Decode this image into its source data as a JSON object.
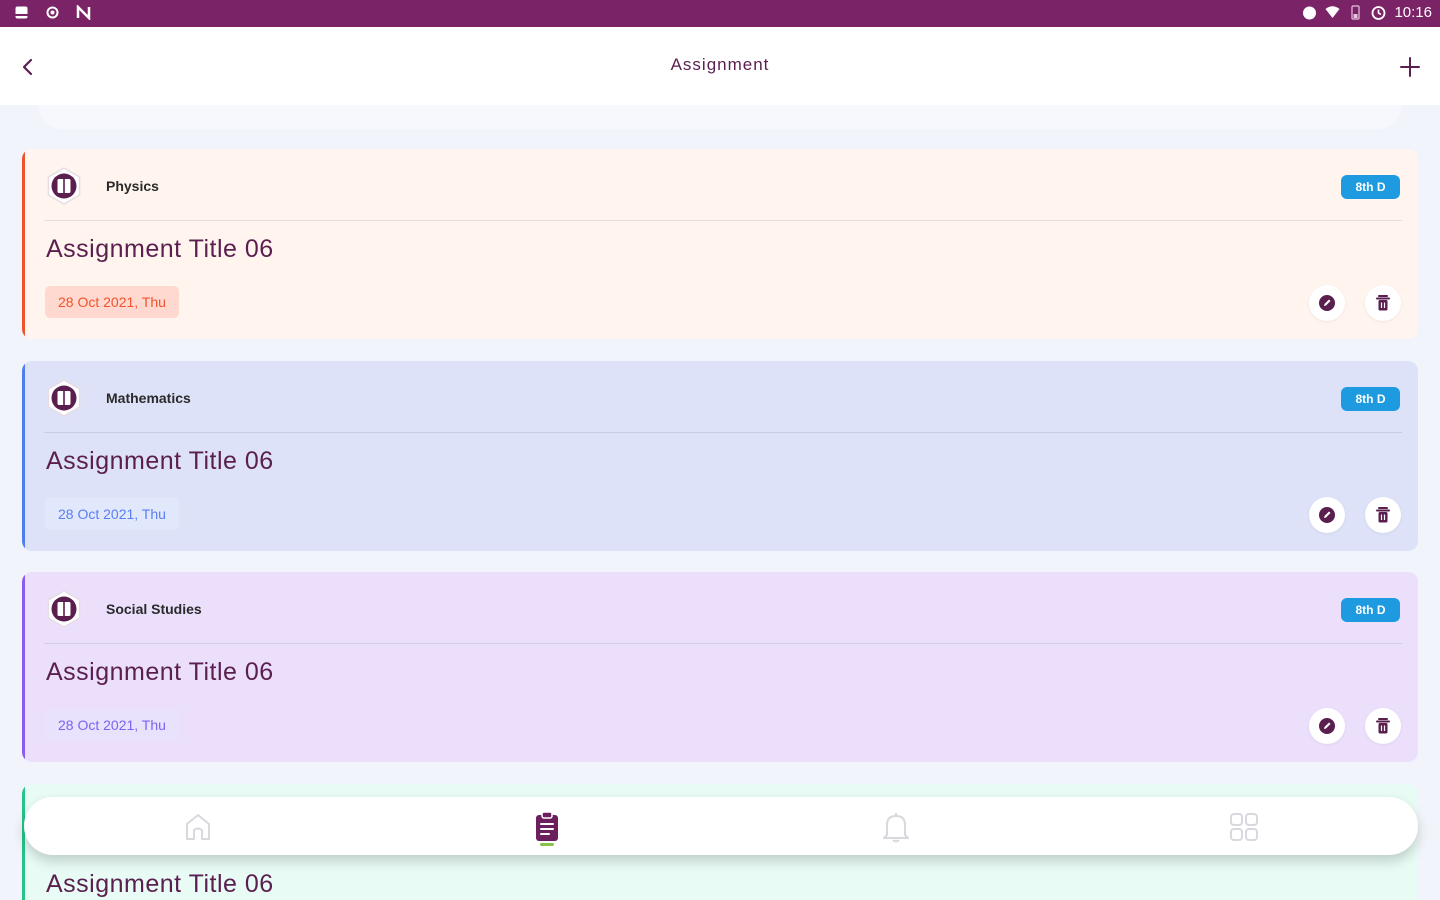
{
  "status_bar": {
    "time": "10:16"
  },
  "header": {
    "title": "Assignment"
  },
  "assignments": [
    {
      "subject": "Physics",
      "class_label": "8th D",
      "title": "Assignment Title 06",
      "date": "28 Oct 2021, Thu",
      "accent": "#f0532c"
    },
    {
      "subject": "Mathematics",
      "class_label": "8th D",
      "title": "Assignment Title 06",
      "date": "28 Oct 2021, Thu",
      "accent": "#4f7ef0"
    },
    {
      "subject": "Social Studies",
      "class_label": "8th D",
      "title": "Assignment Title 06",
      "date": "28 Oct 2021, Thu",
      "accent": "#8a5cf0"
    },
    {
      "subject": "",
      "class_label": "",
      "title": "Assignment Title 06",
      "date": "",
      "accent": "#27c48a"
    }
  ],
  "bottom_nav": {
    "items": [
      {
        "icon": "home-icon",
        "active": false
      },
      {
        "icon": "assignment-icon",
        "active": true
      },
      {
        "icon": "bell-icon",
        "active": false
      },
      {
        "icon": "grid-icon",
        "active": false
      }
    ],
    "active_color": "#6b1f5d",
    "indicator_color": "#8bc34a"
  },
  "colors": {
    "status_bar": "#7a2366",
    "brand": "#5a1f4f",
    "badge": "#1e9be0"
  }
}
